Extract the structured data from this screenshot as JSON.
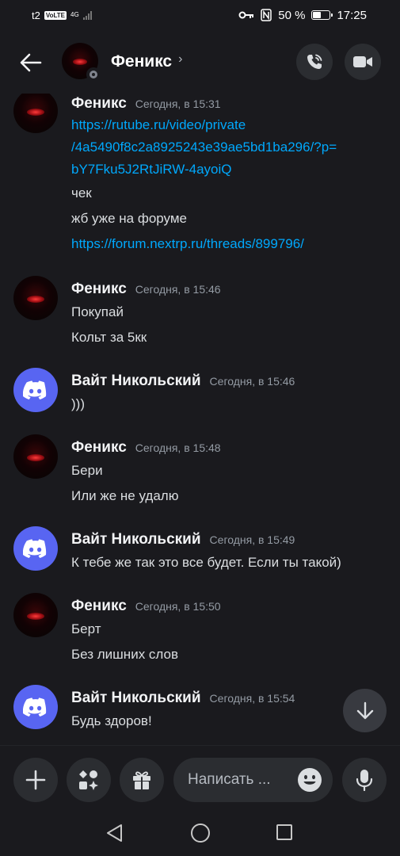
{
  "status_bar": {
    "carrier": "t2",
    "volte": "VoLTE",
    "network": "4G",
    "battery_text": "50 %",
    "battery_level": 0.5,
    "time": "17:25"
  },
  "header": {
    "title": "Феникс",
    "chevron": "›"
  },
  "messages": [
    {
      "author": "Феникс",
      "time": "Сегодня, в 15:31",
      "avatar": "fenix",
      "lines": [
        {
          "text": "https://rutube.ru/video/private",
          "link": true
        },
        {
          "text": "/4a5490f8c2a8925243e39ae5bd1ba296/?p=",
          "link": true
        },
        {
          "text": "bY7Fku5J2RtJiRW-4ayoiQ",
          "link": true
        },
        {
          "text": "чек",
          "link": false
        },
        {
          "text": "жб уже на форуме",
          "link": false
        },
        {
          "text": "https://forum.nextrp.ru/threads/899796/",
          "link": true
        }
      ]
    },
    {
      "author": "Феникс",
      "time": "Сегодня, в 15:46",
      "avatar": "fenix",
      "lines": [
        {
          "text": "Покупай",
          "link": false
        },
        {
          "text": "Кольт за 5кк",
          "link": false
        }
      ]
    },
    {
      "author": "Вайт Никольский",
      "time": "Сегодня, в 15:46",
      "avatar": "discord",
      "lines": [
        {
          "text": ")))",
          "link": false
        }
      ]
    },
    {
      "author": "Феникс",
      "time": "Сегодня, в 15:48",
      "avatar": "fenix",
      "lines": [
        {
          "text": "Бери",
          "link": false
        },
        {
          "text": "Или же не удалю",
          "link": false
        }
      ]
    },
    {
      "author": "Вайт Никольский",
      "time": "Сегодня, в 15:49",
      "avatar": "discord",
      "lines": [
        {
          "text": "К тебе же так это все будет. Если ты такой)",
          "link": false
        }
      ]
    },
    {
      "author": "Феникс",
      "time": "Сегодня, в 15:50",
      "avatar": "fenix",
      "lines": [
        {
          "text": "Берт",
          "link": false
        },
        {
          "text": "Без лишних слов",
          "link": false
        }
      ]
    },
    {
      "author": "Вайт Никольский",
      "time": "Сегодня, в 15:54",
      "avatar": "discord",
      "lines": [
        {
          "text": "Будь здоров!",
          "link": false
        }
      ]
    }
  ],
  "composer": {
    "placeholder": "Написать ..."
  },
  "icons": {
    "back": "arrow-left-icon",
    "call": "phone-call-icon",
    "video": "video-camera-icon",
    "scroll_down": "arrow-down-icon",
    "plus": "plus-icon",
    "apps": "apps-icon",
    "gift": "gift-icon",
    "emoji": "emoji-icon",
    "mic": "microphone-icon"
  },
  "colors": {
    "background": "#1a1a1e",
    "link": "#00a8fc",
    "discord_blurple": "#5865f2",
    "button_bg": "#2b2d31"
  }
}
